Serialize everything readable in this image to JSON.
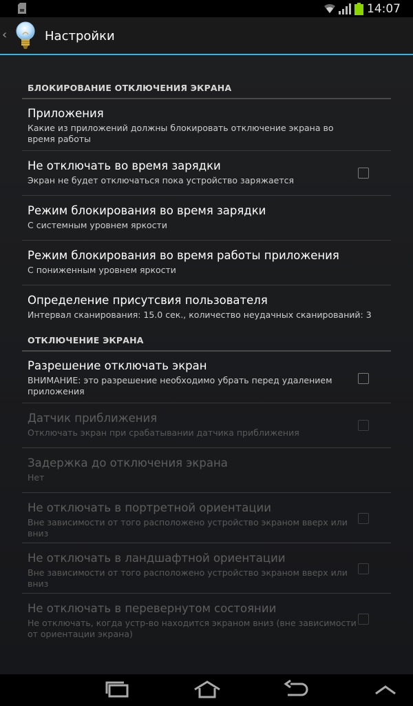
{
  "status_bar": {
    "time": "14:07"
  },
  "action_bar": {
    "back_glyph": "‹",
    "title": "Настройки"
  },
  "sections": {
    "lock": {
      "header": "БЛОКИРОВАНИЕ ОТКЛЮЧЕНИЯ ЭКРАНА"
    },
    "off": {
      "header": "ОТКЛЮЧЕНИЕ ЭКРАНА"
    }
  },
  "prefs": [
    {
      "title": "Приложения",
      "summary": "Какие из приложений должны блокировать отключение экрана во время работы",
      "checkbox": false,
      "enabled": true
    },
    {
      "title": "Не отключать во время зарядки",
      "summary": "Экран не будет отключаться пока устройство заряжается",
      "checkbox": true,
      "checked": false,
      "enabled": true
    },
    {
      "title": "Режим блокирования во время зарядки",
      "summary": "С системным уровнем яркости",
      "checkbox": false,
      "enabled": true
    },
    {
      "title": "Режим блокирования во время работы приложения",
      "summary": "С пониженным уровнем яркости",
      "checkbox": false,
      "enabled": true
    },
    {
      "title": "Определение присутсвия пользователя",
      "summary": "Интервал сканирования: 15.0 сек., количество неудачных сканирований: 3",
      "checkbox": false,
      "enabled": true
    },
    {
      "title": "Разрешение отключать экран",
      "summary": "ВНИМАНИЕ: это разрешение необходимо убрать перед удалением приложения",
      "checkbox": true,
      "checked": false,
      "enabled": true
    },
    {
      "title": "Датчик приближения",
      "summary": "Отключать экран при срабатывании датчика приближения",
      "checkbox": true,
      "checked": false,
      "enabled": false
    },
    {
      "title": "Задержка до отключения экрана",
      "summary": "Нет",
      "checkbox": false,
      "enabled": false
    },
    {
      "title": "Не отключать в портретной ориентации",
      "summary": "Вне зависимости от того расположено устройство экраном вверх или вниз",
      "checkbox": true,
      "checked": false,
      "enabled": false
    },
    {
      "title": "Не отключать в ландшафтной ориентации",
      "summary": "Вне зависимости от того расположено устройство экраном вверх или вниз",
      "checkbox": true,
      "checked": false,
      "enabled": false
    },
    {
      "title": "Не отключать в перевернутом состоянии",
      "summary": "Не отключать, когда устр-во находится экраном вниз (вне зависимости от ориентации экрана)",
      "checkbox": true,
      "checked": false,
      "enabled": false
    }
  ],
  "icons": {
    "sd": "sd-card-icon",
    "wifi": "wifi-icon",
    "signal": "signal-icon",
    "battery": "battery-icon",
    "app": "lightbulb-icon",
    "recent": "recent-apps-icon",
    "home": "home-icon",
    "back": "back-icon",
    "menu": "chevron-up-icon"
  },
  "colors": {
    "accent": "#33b5e5",
    "battery": "#8bd400"
  }
}
